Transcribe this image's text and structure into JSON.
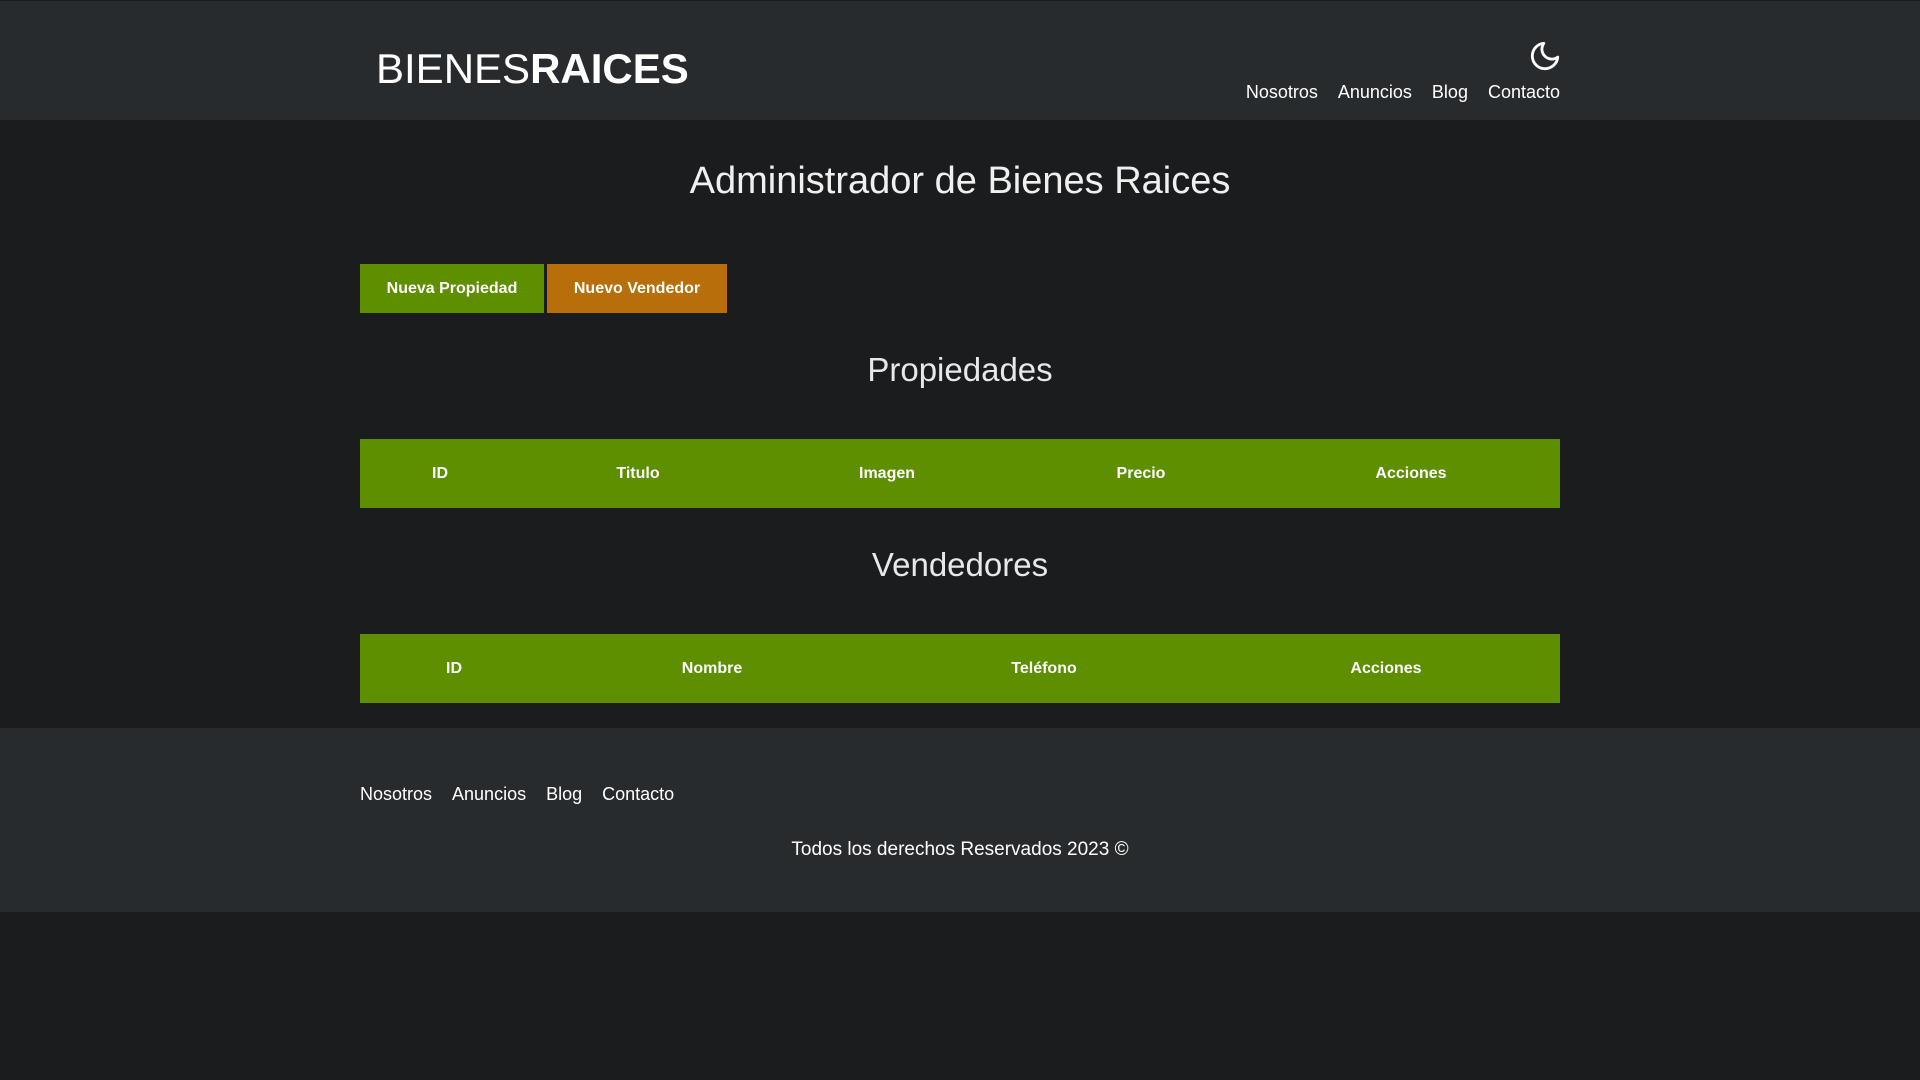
{
  "header": {
    "logo_light": "BIENES",
    "logo_bold": "RAICES",
    "theme_toggle_icon": "moon-icon",
    "nav": [
      {
        "label": "Nosotros"
      },
      {
        "label": "Anuncios"
      },
      {
        "label": "Blog"
      },
      {
        "label": "Contacto"
      }
    ]
  },
  "main": {
    "title": "Administrador de Bienes Raices",
    "buttons": {
      "new_property": "Nueva Propiedad",
      "new_seller": "Nuevo Vendedor"
    },
    "properties": {
      "title": "Propiedades",
      "columns": [
        "ID",
        "Titulo",
        "Imagen",
        "Precio",
        "Acciones"
      ]
    },
    "sellers": {
      "title": "Vendedores",
      "columns": [
        "ID",
        "Nombre",
        "Teléfono",
        "Acciones"
      ]
    }
  },
  "footer": {
    "nav": [
      {
        "label": "Nosotros"
      },
      {
        "label": "Anuncios"
      },
      {
        "label": "Blog"
      },
      {
        "label": "Contacto"
      }
    ],
    "copyright": "Todos los derechos Reservados 2023 ©"
  },
  "colors": {
    "primary_green": "#5d8f00",
    "accent_orange": "#b86e0a",
    "header_bg": "#282b2d",
    "page_bg": "#1a1c1e"
  }
}
